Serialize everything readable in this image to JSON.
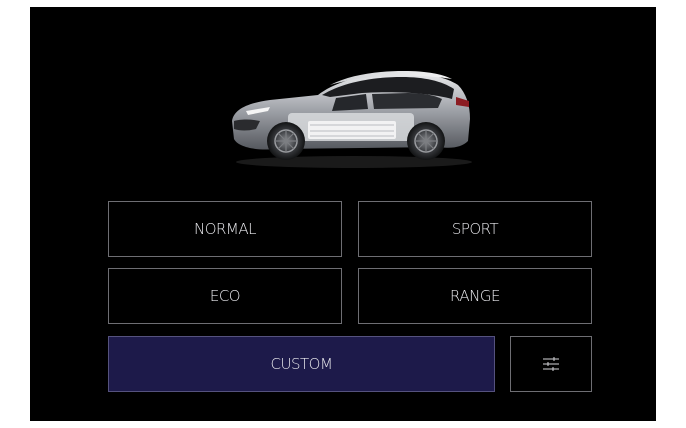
{
  "drive_modes": {
    "selected": "custom",
    "normal_label": "NORMAL",
    "sport_label": "SPORT",
    "eco_label": "ECO",
    "range_label": "RANGE",
    "custom_label": "CUSTOM",
    "settings_icon": "sliders-icon"
  },
  "colors": {
    "background": "#000000",
    "button_border": "#6e6e73",
    "button_text": "#e8e8ec",
    "selected_fill": "#1d1a4a"
  }
}
